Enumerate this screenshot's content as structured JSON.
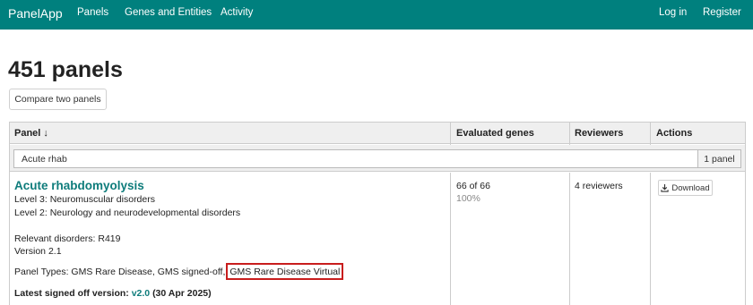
{
  "navbar": {
    "brand": "PanelApp",
    "links": [
      "Panels",
      "Genes and Entities",
      "Activity"
    ],
    "right_links": [
      "Log in",
      "Register"
    ],
    "color": "#00807e"
  },
  "page_title": "451 panels",
  "compare_button": "Compare two panels",
  "table": {
    "headers": {
      "panel": "Panel",
      "sort_indicator": "↓",
      "evaluated": "Evaluated genes",
      "reviewers": "Reviewers",
      "actions": "Actions"
    },
    "filter": {
      "value": "Acute rhab",
      "count": "1 panel"
    },
    "row": {
      "name": "Acute rhabdomyolysis",
      "level3": "Level 3: Neuromuscular disorders",
      "level2": "Level 2: Neurology and neurodevelopmental disorders",
      "relevant_disorders": "Relevant disorders: R419",
      "version": "Version 2.1",
      "panel_types_prefix": "Panel Types: GMS Rare Disease, GMS signed-off,",
      "panel_types_highlighted": "GMS Rare Disease Virtual",
      "signed_off_label": "Latest signed off version:",
      "signed_off_version": "v2.0",
      "signed_off_date": "(30 Apr 2025)",
      "evaluated": "66 of 66",
      "evaluated_percent": "100%",
      "reviewers": "4 reviewers",
      "download": "Download",
      "highlight_color": "#c81d1d"
    }
  }
}
